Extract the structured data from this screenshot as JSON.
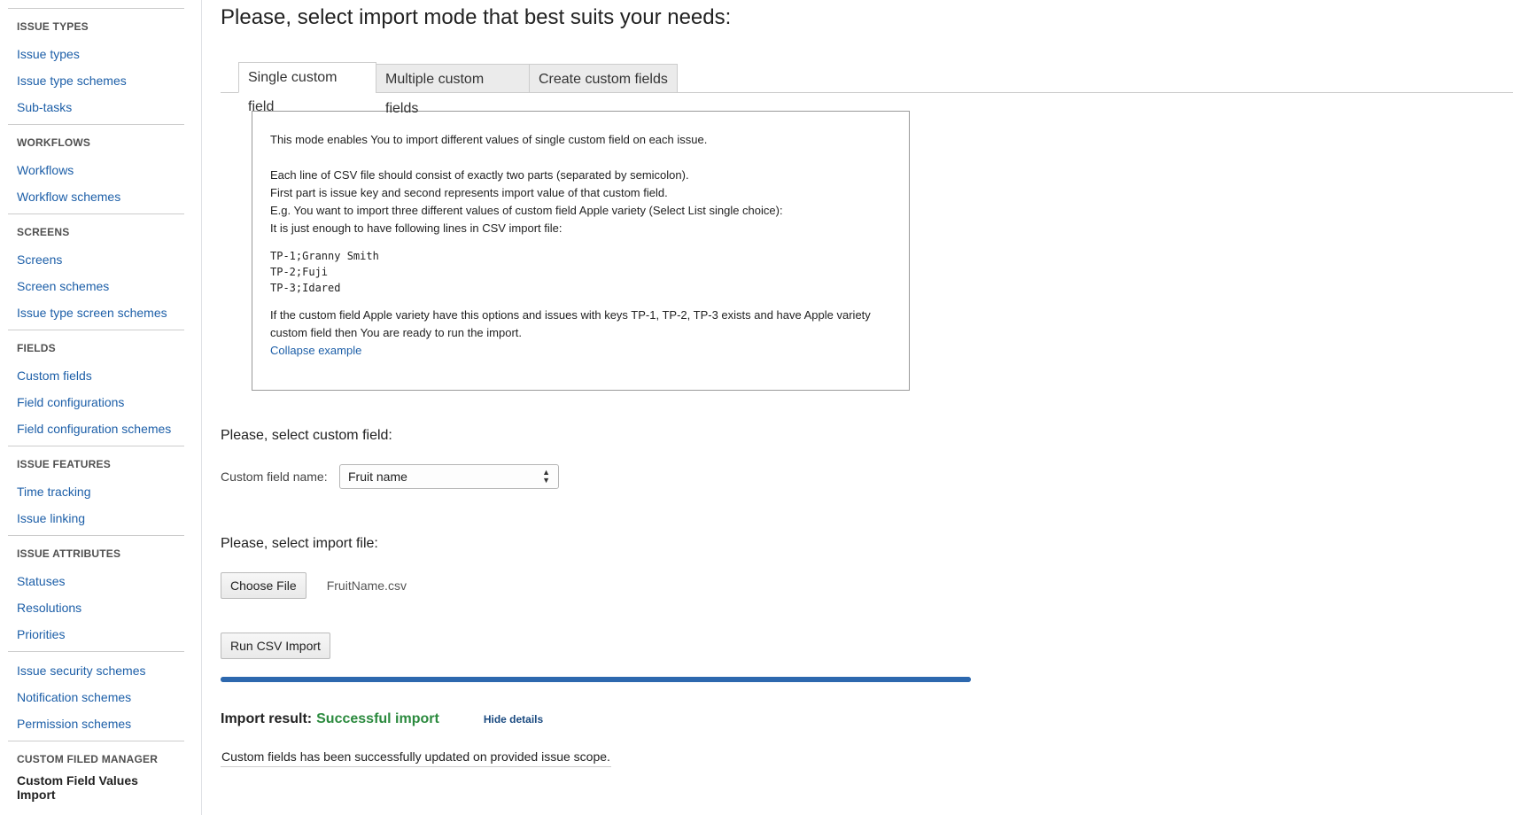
{
  "sidebar": {
    "sections": [
      {
        "heading": "ISSUE TYPES",
        "items": [
          "Issue types",
          "Issue type schemes",
          "Sub-tasks"
        ]
      },
      {
        "heading": "WORKFLOWS",
        "items": [
          "Workflows",
          "Workflow schemes"
        ]
      },
      {
        "heading": "SCREENS",
        "items": [
          "Screens",
          "Screen schemes",
          "Issue type screen schemes"
        ]
      },
      {
        "heading": "FIELDS",
        "items": [
          "Custom fields",
          "Field configurations",
          "Field configuration schemes"
        ]
      },
      {
        "heading": "ISSUE FEATURES",
        "items": [
          "Time tracking",
          "Issue linking"
        ]
      },
      {
        "heading": "ISSUE ATTRIBUTES",
        "items": [
          "Statuses",
          "Resolutions",
          "Priorities"
        ]
      },
      {
        "heading": "",
        "items": [
          "Issue security schemes",
          "Notification schemes",
          "Permission schemes"
        ]
      },
      {
        "heading": "CUSTOM FILED MANAGER",
        "active_item": "Custom Field Values Import"
      }
    ]
  },
  "main": {
    "title": "Please, select import mode that best suits your needs:",
    "tabs": [
      {
        "label": "Single custom field",
        "active": true
      },
      {
        "label": "Multiple custom fields",
        "active": false
      },
      {
        "label": "Create custom fields",
        "active": false
      }
    ],
    "info": {
      "intro": "This mode enables You to import different values of single custom field on each issue.",
      "line1": "Each line of CSV file should consist of exactly two parts (separated by semicolon).",
      "line2": "First part is issue key and second represents import value of that custom field.",
      "line3": "E.g. You want to import three different values of custom field Apple variety (Select List single choice):",
      "line4": "It is just enough to have following lines in CSV import file:",
      "code": [
        "TP-1;Granny Smith",
        "TP-2;Fuji",
        "TP-3;Idared"
      ],
      "outro": "If the custom field Apple variety have this options and issues with keys TP-1, TP-2, TP-3 exists and have Apple variety custom field then You are ready to run the import.",
      "collapse_link": "Collapse example"
    },
    "custom_field_section": {
      "label": "Please, select custom field:",
      "field_label": "Custom field name:",
      "selected_value": "Fruit name"
    },
    "file_section": {
      "label": "Please, select import file:",
      "choose_button": "Choose File",
      "file_name": "FruitName.csv"
    },
    "run_button": "Run CSV Import",
    "progress": {
      "percent": 100,
      "color": "#2d68ae"
    },
    "result": {
      "label": "Import result:",
      "status": "Successful import",
      "status_color": "#2b8a3e",
      "hide_details": "Hide details",
      "message": "Custom fields has been successfully updated on provided issue scope."
    }
  }
}
